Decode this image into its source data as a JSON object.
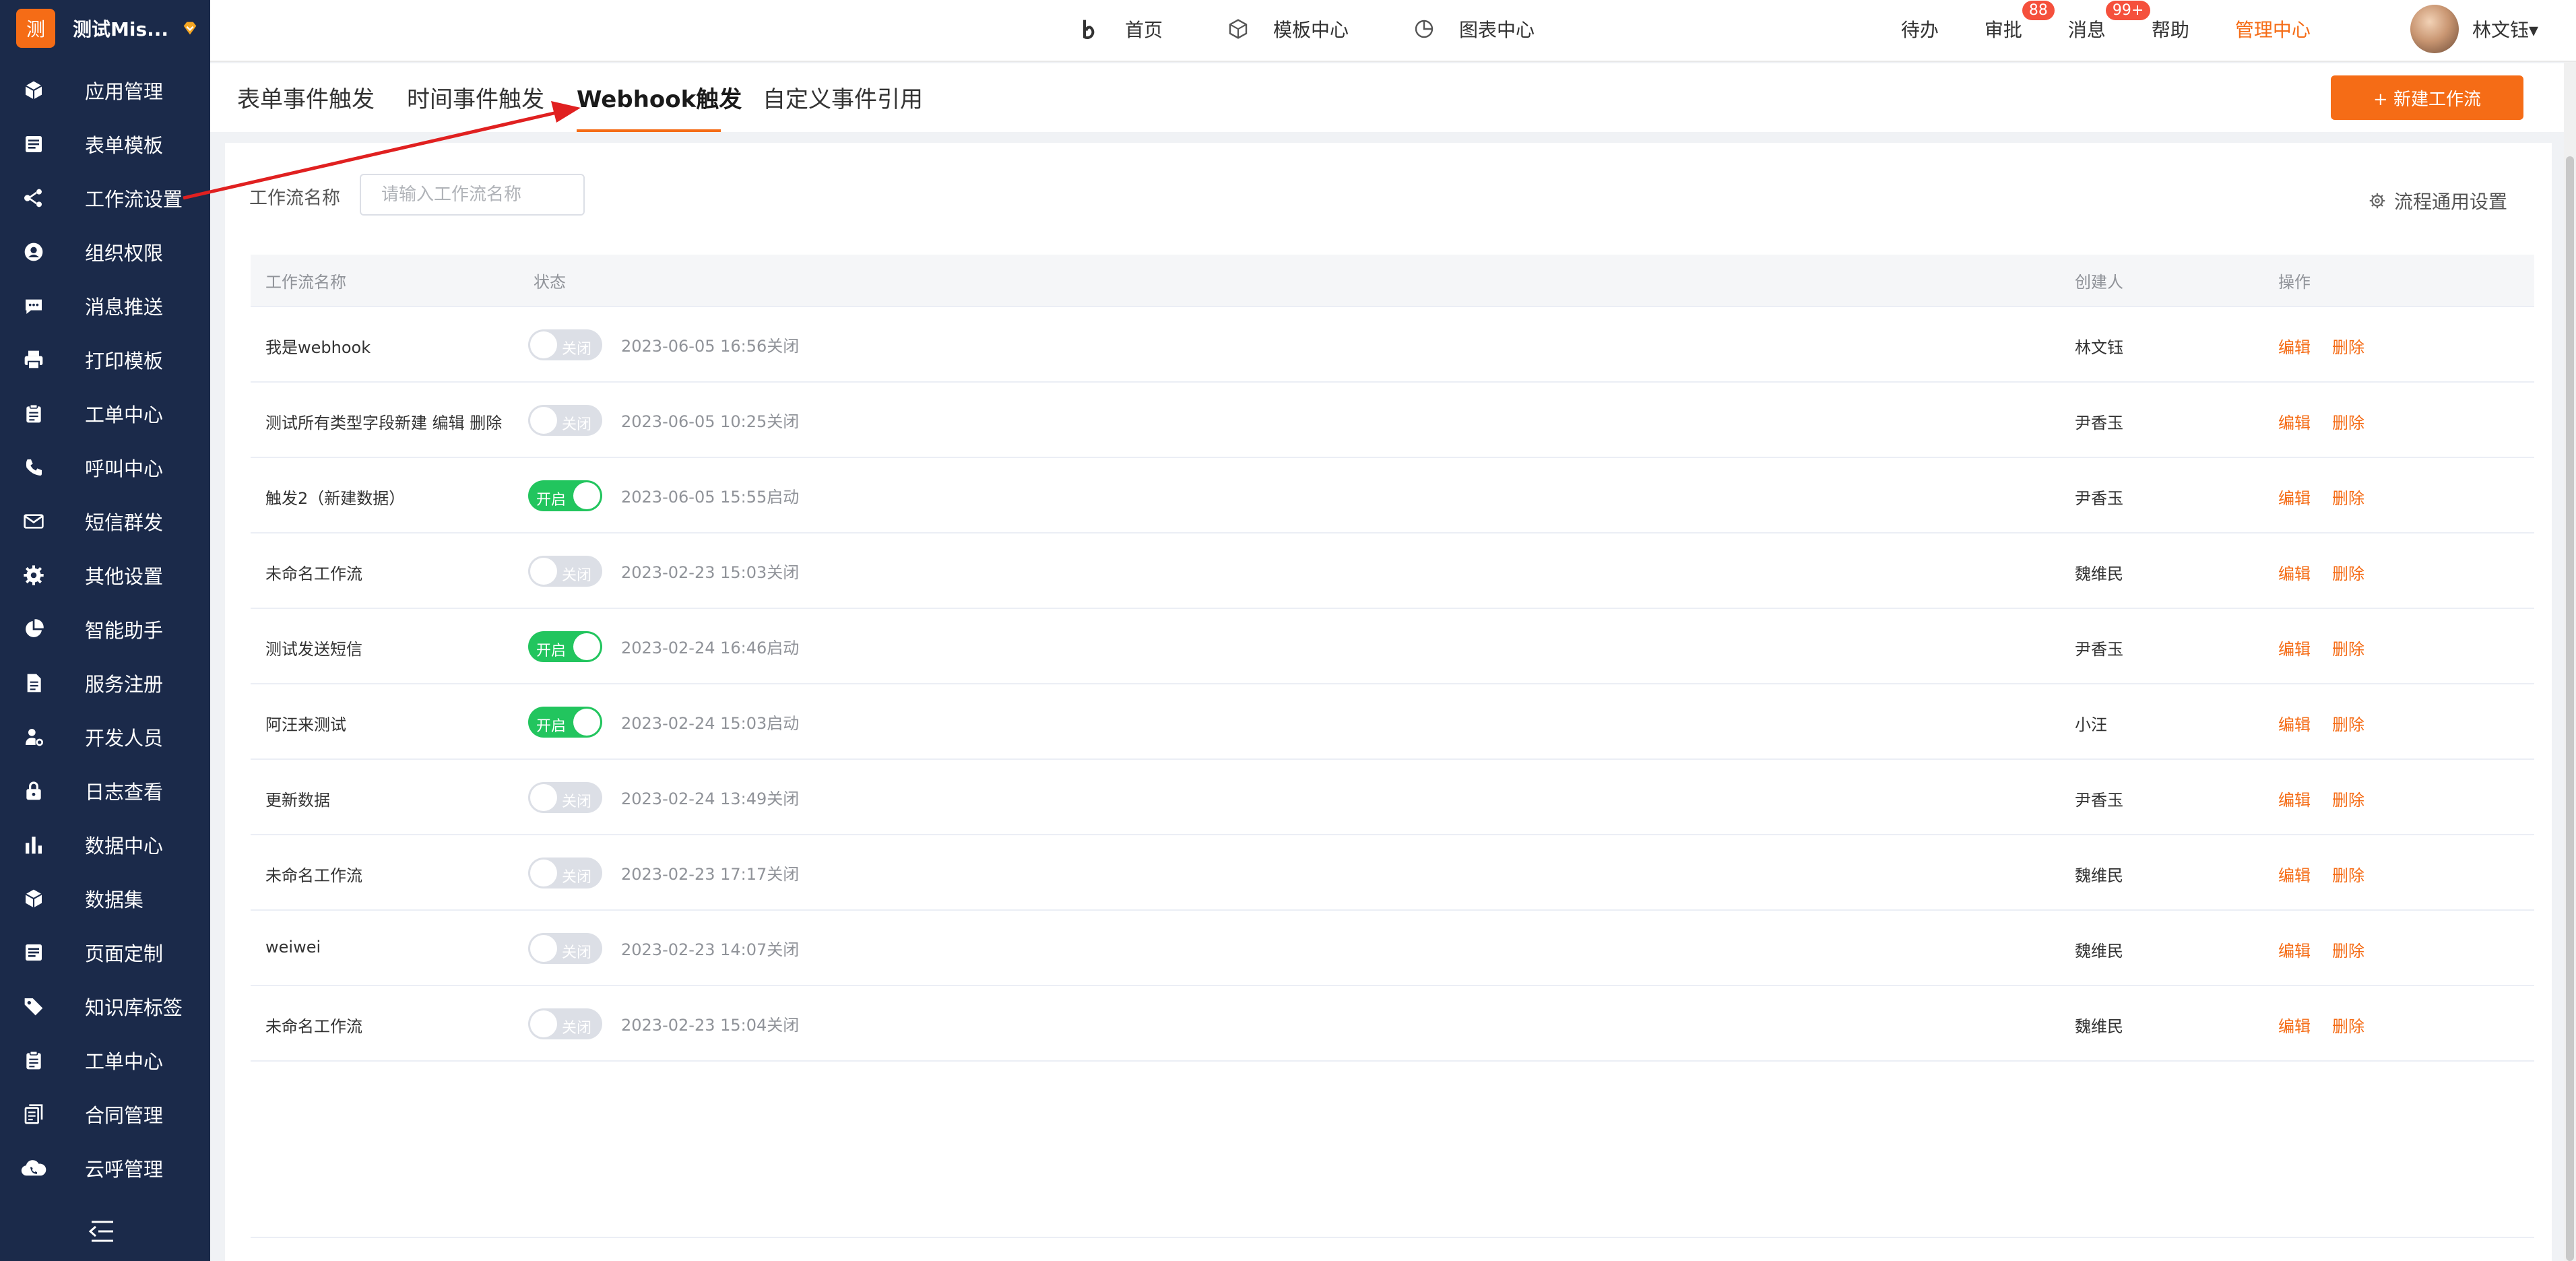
{
  "brand": {
    "logo_char": "测",
    "name": "测试Mis..."
  },
  "sidebar": {
    "items": [
      {
        "label": "应用管理",
        "icon": "cube-icon"
      },
      {
        "label": "表单模板",
        "icon": "form-icon"
      },
      {
        "label": "工作流设置",
        "icon": "workflow-icon"
      },
      {
        "label": "组织权限",
        "icon": "user-circle-icon"
      },
      {
        "label": "消息推送",
        "icon": "message-icon"
      },
      {
        "label": "打印模板",
        "icon": "printer-icon"
      },
      {
        "label": "工单中心",
        "icon": "clipboard-icon"
      },
      {
        "label": "呼叫中心",
        "icon": "phone-icon"
      },
      {
        "label": "短信群发",
        "icon": "envelope-icon"
      },
      {
        "label": "其他设置",
        "icon": "gear-icon"
      },
      {
        "label": "智能助手",
        "icon": "pie-icon"
      },
      {
        "label": "服务注册",
        "icon": "document-icon"
      },
      {
        "label": "开发人员",
        "icon": "developer-icon"
      },
      {
        "label": "日志查看",
        "icon": "lock-icon"
      },
      {
        "label": "数据中心",
        "icon": "bar-chart-icon"
      },
      {
        "label": "数据集",
        "icon": "cube-icon"
      },
      {
        "label": "页面定制",
        "icon": "form-icon"
      },
      {
        "label": "知识库标签",
        "icon": "tag-icon"
      },
      {
        "label": "工单中心",
        "icon": "clipboard-icon"
      },
      {
        "label": "合同管理",
        "icon": "contract-icon"
      },
      {
        "label": "云呼管理",
        "icon": "cloud-phone-icon"
      }
    ]
  },
  "topbar": {
    "nav": [
      {
        "label": "首页",
        "icon": "b-logo-icon"
      },
      {
        "label": "模板中心",
        "icon": "box-icon"
      },
      {
        "label": "图表中心",
        "icon": "chart-circle-icon"
      }
    ],
    "todo": "待办",
    "approval": "审批",
    "approval_badge": "88",
    "messages": "消息",
    "messages_badge": "99+",
    "help": "帮助",
    "admin_center": "管理中心",
    "user_name": "林文钰▾"
  },
  "tabs": [
    "表单事件触发",
    "时间事件触发",
    "Webhook触发",
    "自定义事件引用"
  ],
  "active_tab": "Webhook触发",
  "new_flow_button": "+ 新建工作流",
  "filter": {
    "label": "工作流名称",
    "placeholder": "请输入工作流名称"
  },
  "general_settings": "流程通用设置",
  "table": {
    "headers": {
      "name": "工作流名称",
      "status": "状态",
      "creator": "创建人",
      "actions": "操作"
    },
    "on_text": "开启",
    "off_text": "关闭",
    "edit": "编辑",
    "delete": "删除",
    "rows": [
      {
        "name": "我是webhook",
        "enabled": false,
        "status": "2023-06-05 16:56关闭",
        "creator": "林文钰"
      },
      {
        "name": "测试所有类型字段新建 编辑 删除",
        "enabled": false,
        "status": "2023-06-05 10:25关闭",
        "creator": "尹香玉"
      },
      {
        "name": "触发2（新建数据）",
        "enabled": true,
        "status": "2023-06-05 15:55启动",
        "creator": "尹香玉"
      },
      {
        "name": "未命名工作流",
        "enabled": false,
        "status": "2023-02-23 15:03关闭",
        "creator": "魏维民"
      },
      {
        "name": "测试发送短信",
        "enabled": true,
        "status": "2023-02-24 16:46启动",
        "creator": "尹香玉"
      },
      {
        "name": "阿汪来测试",
        "enabled": true,
        "status": "2023-02-24 15:03启动",
        "creator": "小汪"
      },
      {
        "name": "更新数据",
        "enabled": false,
        "status": "2023-02-24 13:49关闭",
        "creator": "尹香玉"
      },
      {
        "name": "未命名工作流",
        "enabled": false,
        "status": "2023-02-23 17:17关闭",
        "creator": "魏维民"
      },
      {
        "name": "weiwei",
        "enabled": false,
        "status": "2023-02-23 14:07关闭",
        "creator": "魏维民"
      },
      {
        "name": "未命名工作流",
        "enabled": false,
        "status": "2023-02-23 15:04关闭",
        "creator": "魏维民"
      }
    ]
  },
  "colors": {
    "accent": "#f56c16",
    "sidebar_bg": "#1b2a4a",
    "switch_on": "#22c55e",
    "annotation": "#e02020"
  }
}
